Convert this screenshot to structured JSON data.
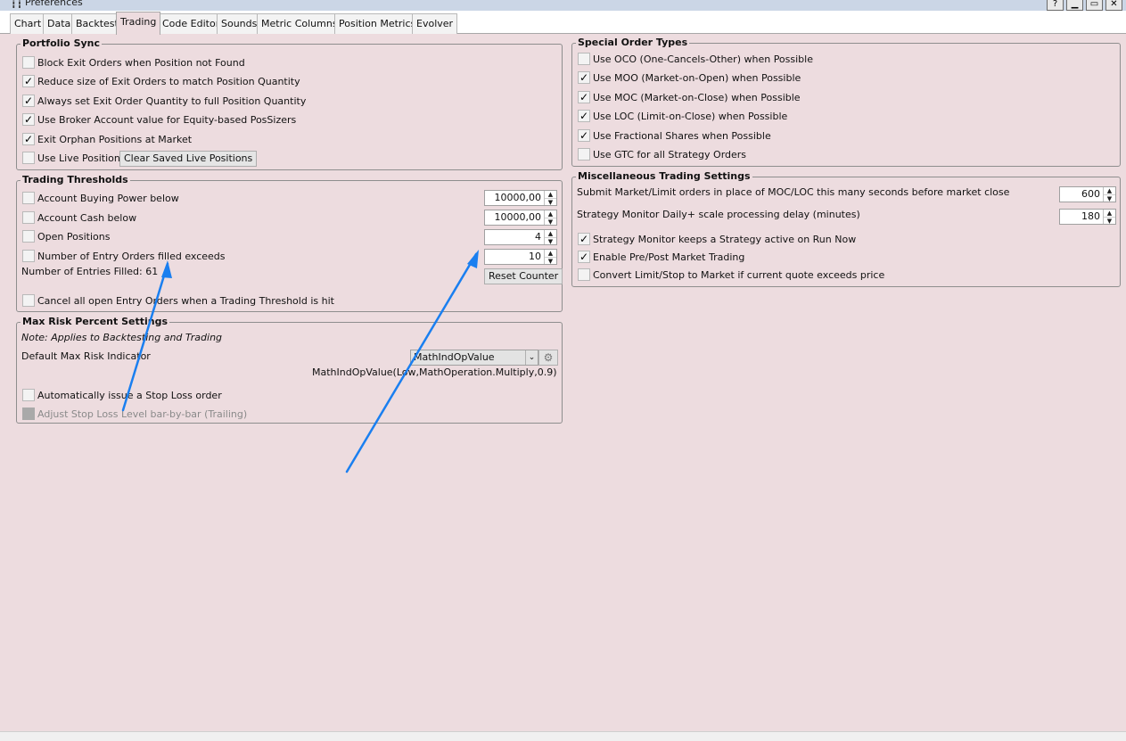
{
  "window": {
    "title": "Preferences",
    "icon": "sliders-icon",
    "buttons": {
      "help": "?",
      "minimize": "▁",
      "maximize": "▭",
      "close": "✕"
    }
  },
  "tabs": [
    {
      "label": "Chart"
    },
    {
      "label": "Data"
    },
    {
      "label": "Backtest"
    },
    {
      "label": "Trading",
      "active": true
    },
    {
      "label": "Code Editor"
    },
    {
      "label": "Sounds"
    },
    {
      "label": "Metric Columns"
    },
    {
      "label": "Position Metrics"
    },
    {
      "label": "Evolver"
    }
  ],
  "portfolio_sync": {
    "title": "Portfolio Sync",
    "items": [
      {
        "label": "Block Exit Orders when Position not Found",
        "checked": false
      },
      {
        "label": "Reduce size of Exit Orders to match Position Quantity",
        "checked": true
      },
      {
        "label": "Always set Exit Order Quantity to full Position Quantity",
        "checked": true
      },
      {
        "label": "Use Broker Account value for Equity-based PosSizers",
        "checked": true
      },
      {
        "label": "Exit Orphan Positions at Market",
        "checked": true
      },
      {
        "label": "Use Live Positions",
        "checked": false
      }
    ],
    "clear_button": "Clear Saved Live Positions"
  },
  "trading_thresholds": {
    "title": "Trading Thresholds",
    "items": [
      {
        "label": "Account Buying Power below",
        "checked": false,
        "value": "10000,00"
      },
      {
        "label": "Account Cash below",
        "checked": false,
        "value": "10000,00"
      },
      {
        "label": "Open Positions",
        "checked": false,
        "value": "4"
      },
      {
        "label": "Number of Entry Orders filled exceeds",
        "checked": false,
        "value": "10"
      }
    ],
    "entries_filled": "Number of Entries Filled: 61",
    "reset_button": "Reset Counter",
    "cancel_label": "Cancel all open Entry Orders when a Trading Threshold is hit",
    "cancel_checked": false
  },
  "max_risk": {
    "title": "Max Risk Percent Settings",
    "note": "Note: Applies to Backtesting and Trading",
    "indicator_label": "Default Max Risk Indicator",
    "indicator_value": "MathIndOpValue",
    "indicator_expression": "MathIndOpValue(Low,MathOperation.Multiply,0.9)",
    "auto_stop_label": "Automatically issue a Stop Loss order",
    "auto_stop_checked": false,
    "trailing_label": "Adjust Stop Loss Level bar-by-bar (Trailing)",
    "trailing_checked": false
  },
  "special_orders": {
    "title": "Special Order Types",
    "items": [
      {
        "label": "Use OCO (One-Cancels-Other) when Possible",
        "checked": false
      },
      {
        "label": "Use MOO (Market-on-Open) when Possible",
        "checked": true
      },
      {
        "label": "Use MOC (Market-on-Close) when Possible",
        "checked": true
      },
      {
        "label": "Use LOC (Limit-on-Close) when Possible",
        "checked": true
      },
      {
        "label": "Use Fractional Shares when Possible",
        "checked": true
      },
      {
        "label": "Use GTC for all Strategy Orders",
        "checked": false
      }
    ]
  },
  "misc": {
    "title": "Miscellaneous Trading Settings",
    "submit_label": "Submit Market/Limit orders in place of MOC/LOC this many seconds before market close",
    "submit_value": "600",
    "delay_label": "Strategy Monitor Daily+ scale processing delay (minutes)",
    "delay_value": "180",
    "items": [
      {
        "label": "Strategy Monitor keeps a Strategy active on Run Now",
        "checked": true
      },
      {
        "label": "Enable Pre/Post Market Trading",
        "checked": true
      },
      {
        "label": "Convert Limit/Stop to Market if current quote exceeds price",
        "checked": false
      }
    ]
  },
  "colors": {
    "panel_bg": "#eddcdf",
    "annotation_arrow": "#1a7ff0"
  },
  "icons": {
    "check": "✓",
    "spin_up": "▲",
    "spin_down": "▼",
    "chevron": "⌄",
    "gear": "⚙"
  }
}
